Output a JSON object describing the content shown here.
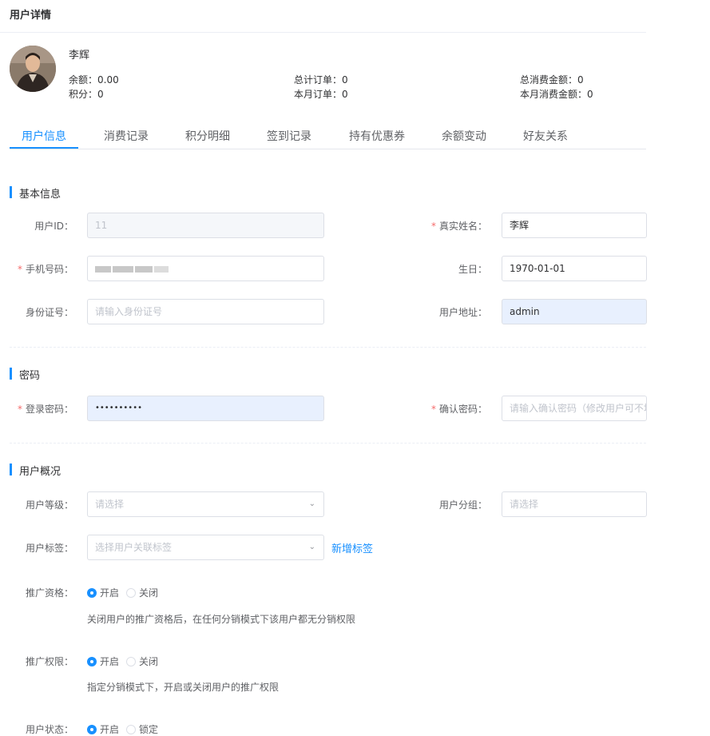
{
  "page": {
    "title": "用户详情"
  },
  "profile": {
    "name": "李辉",
    "stats": {
      "balance": "余额：0.00",
      "points": "积分：0",
      "total_orders": "总计订单：0",
      "month_orders": "本月订单：0",
      "total_spent": "总消费金额：0",
      "month_spent": "本月消费金额：0"
    }
  },
  "tabs": [
    "用户信息",
    "消费记录",
    "积分明细",
    "签到记录",
    "持有优惠券",
    "余额变动",
    "好友关系"
  ],
  "sections": {
    "basic": "基本信息",
    "password": "密码",
    "overview": "用户概况"
  },
  "required_mark": "*",
  "form": {
    "user_id": {
      "label": "用户ID：",
      "value": "11"
    },
    "real_name": {
      "label": "真实姓名：",
      "value": "李辉"
    },
    "phone": {
      "label": "手机号码："
    },
    "birthday": {
      "label": "生日：",
      "value": "1970-01-01"
    },
    "id_card": {
      "label": "身份证号：",
      "placeholder": "请输入身份证号"
    },
    "address": {
      "label": "用户地址：",
      "value": "admin"
    },
    "login_password": {
      "label": "登录密码：",
      "value": "••••••••••"
    },
    "confirm_password": {
      "label": "确认密码：",
      "placeholder": "请输入确认密码（修改用户可不填"
    },
    "level": {
      "label": "用户等级：",
      "placeholder": "请选择"
    },
    "group": {
      "label": "用户分组：",
      "placeholder": "请选择"
    },
    "tags": {
      "label": "用户标签：",
      "placeholder": "选择用户关联标签",
      "add_link": "新增标签"
    },
    "promo_qualification": {
      "label": "推广资格：",
      "options": [
        "开启",
        "关闭"
      ],
      "selected": "开启",
      "hint": "关闭用户的推广资格后，在任何分销模式下该用户都无分销权限"
    },
    "promo_permission": {
      "label": "推广权限：",
      "options": [
        "开启",
        "关闭"
      ],
      "selected": "开启",
      "hint": "指定分销模式下，开启或关闭用户的推广权限"
    },
    "status": {
      "label": "用户状态：",
      "options": [
        "开启",
        "锁定"
      ],
      "selected": "开启"
    }
  },
  "colors": {
    "accent": "#1890ff",
    "required": "#f56c6c",
    "autofill": "#e8f0fe"
  },
  "icons": {
    "select_arrow": "chevron-down-icon"
  }
}
